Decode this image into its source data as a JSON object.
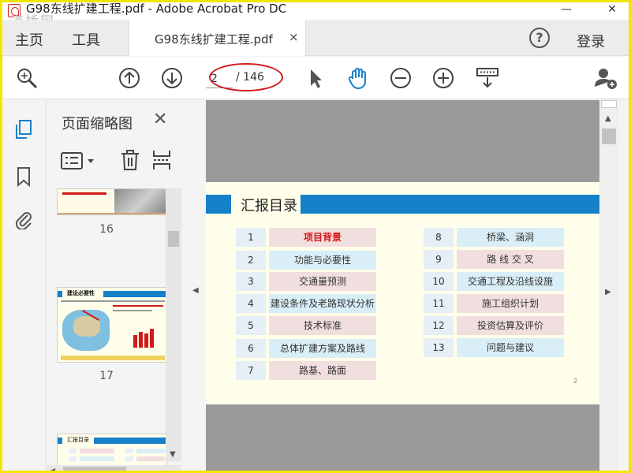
{
  "window": {
    "title": "G98东线扩建工程.pdf - Adobe Acrobat Pro DC",
    "minimize": "—",
    "close": "✕",
    "watermark": "道桥网"
  },
  "menu": {
    "home": "主页",
    "tools": "工具",
    "tab_title": "G98东线扩建工程.pdf",
    "tab_close": "×",
    "help": "?",
    "login": "登录"
  },
  "toolbar": {
    "current_page": "2",
    "total_pages": "/ 146",
    "icons": [
      "search-zoom-icon",
      "page-up-icon",
      "page-down-icon",
      "select-arrow-icon",
      "hand-tool-icon",
      "zoom-out-icon",
      "zoom-in-icon",
      "keyboard-scroll-icon",
      "add-user-icon"
    ],
    "highlight_color": "#d21919"
  },
  "thumbnails_panel": {
    "title": "页面缩略图",
    "close": "✕",
    "thumbs": [
      {
        "page": "16"
      },
      {
        "page": "17"
      }
    ]
  },
  "slide": {
    "title": "汇报目录",
    "accent_color": "#1681c9",
    "page_number": "2",
    "left_items": [
      {
        "num": "1",
        "label": "项目背景"
      },
      {
        "num": "2",
        "label": "功能与必要性"
      },
      {
        "num": "3",
        "label": "交通量预测"
      },
      {
        "num": "4",
        "label": "建设条件及老路现状分析"
      },
      {
        "num": "5",
        "label": "技术标准"
      },
      {
        "num": "6",
        "label": "总体扩建方案及路线"
      },
      {
        "num": "7",
        "label": "路基、路面"
      }
    ],
    "right_items": [
      {
        "num": "8",
        "label": "桥梁、涵洞"
      },
      {
        "num": "9",
        "label": "路 线 交 叉"
      },
      {
        "num": "10",
        "label": "交通工程及沿线设施"
      },
      {
        "num": "11",
        "label": "施工组织计划"
      },
      {
        "num": "12",
        "label": "投资估算及评价"
      },
      {
        "num": "13",
        "label": "问题与建议"
      }
    ]
  },
  "thumb_texts": {
    "thumb17_heading": "建设必要性",
    "thumb18_heading": "汇报目录"
  }
}
